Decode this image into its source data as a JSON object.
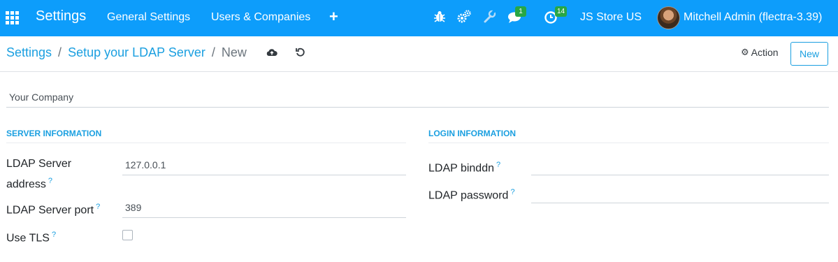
{
  "navbar": {
    "brand": "Settings",
    "menu": [
      "General Settings",
      "Users & Companies"
    ],
    "plus": "+",
    "icons": [
      "bug-icon",
      "cogs-icon",
      "wrench-icon",
      "chat-icon",
      "clock-icon"
    ],
    "chat_badge": "1",
    "activity_badge": "14",
    "store": "JS Store US",
    "user": "Mitchell Admin (flectra-3.39)",
    "color": "#0d9dfb"
  },
  "breadcrumb": {
    "items": [
      "Settings",
      "Setup your LDAP Server"
    ],
    "separator": "/",
    "current": "New"
  },
  "controls": {
    "action_label": "Action",
    "new_label": "New"
  },
  "form": {
    "company": "Your Company",
    "server_section": "SERVER INFORMATION",
    "login_section": "LOGIN INFORMATION",
    "help_mark": "?",
    "fields": {
      "server_address_label_1": "LDAP Server",
      "server_address_label_2": "address",
      "server_address": "127.0.0.1",
      "server_port_label": "LDAP Server port",
      "server_port": "389",
      "tls_label": "Use TLS",
      "tls_checked": false,
      "binddn_label": "LDAP binddn",
      "binddn": "",
      "password_label": "LDAP password",
      "password": ""
    }
  }
}
